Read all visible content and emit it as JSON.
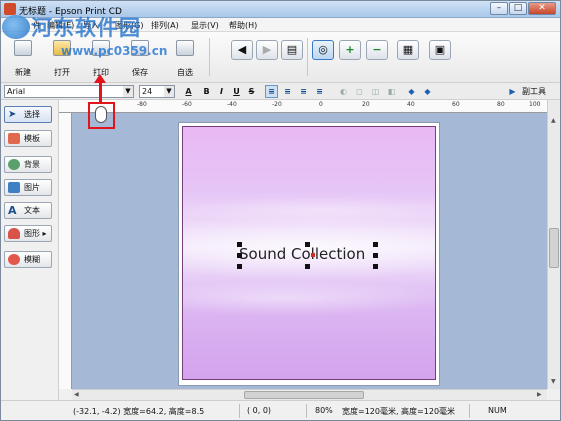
{
  "window": {
    "title": "无标题 - Epson Print CD",
    "min_glyph": "–",
    "max_glyph": "□",
    "close_glyph": "✕"
  },
  "watermark": {
    "line1": "河东软件园",
    "line2": "www.pc0359.cn"
  },
  "menu": {
    "items": [
      "件",
      "编辑(E)",
      "导入",
      "图形(G)",
      "排列(A)",
      "显示(V)",
      "帮助(H)"
    ]
  },
  "toolbar": {
    "new_label": "新建",
    "open_label": "打开",
    "print_label": "打印",
    "save_label": "保存",
    "custom_label": "自选",
    "undo_glyph": "◀",
    "redo_glyph": "▶",
    "layer_glyph": "▤",
    "circle_glyph": "◎",
    "zoom_in_glyph": "+",
    "zoom_out_glyph": "−",
    "grid_glyph": "▦",
    "window_glyph": "▣"
  },
  "format_bar": {
    "font_value": "Arial",
    "size_value": "24",
    "color_glyph": "A",
    "bold": "B",
    "italic": "I",
    "underline": "U",
    "strike": "S",
    "side_panel_label": "副工具"
  },
  "left_panel": {
    "items": [
      "选择",
      "模板",
      "背景",
      "图片",
      "文本",
      "图形 ▸",
      "模糊"
    ]
  },
  "ruler": {
    "h_labels": [
      "-80",
      "-60",
      "-40",
      "-20",
      "0",
      "20",
      "40",
      "60",
      "80",
      "100"
    ]
  },
  "canvas": {
    "text": "Sound Collection",
    "colors": {
      "background": "#a5b9d6",
      "art_top": "#e8b8f4",
      "art_bottom": "#d4a3ee",
      "art_border": "#7a3f7a"
    }
  },
  "status": {
    "position": "(-32.1, -4.2) 宽度=64.2, 高度=8.5",
    "cursor": "(  0,  0)",
    "zoom": "80%",
    "size": "宽度=120毫米, 高度=120毫米",
    "num": "NUM"
  }
}
